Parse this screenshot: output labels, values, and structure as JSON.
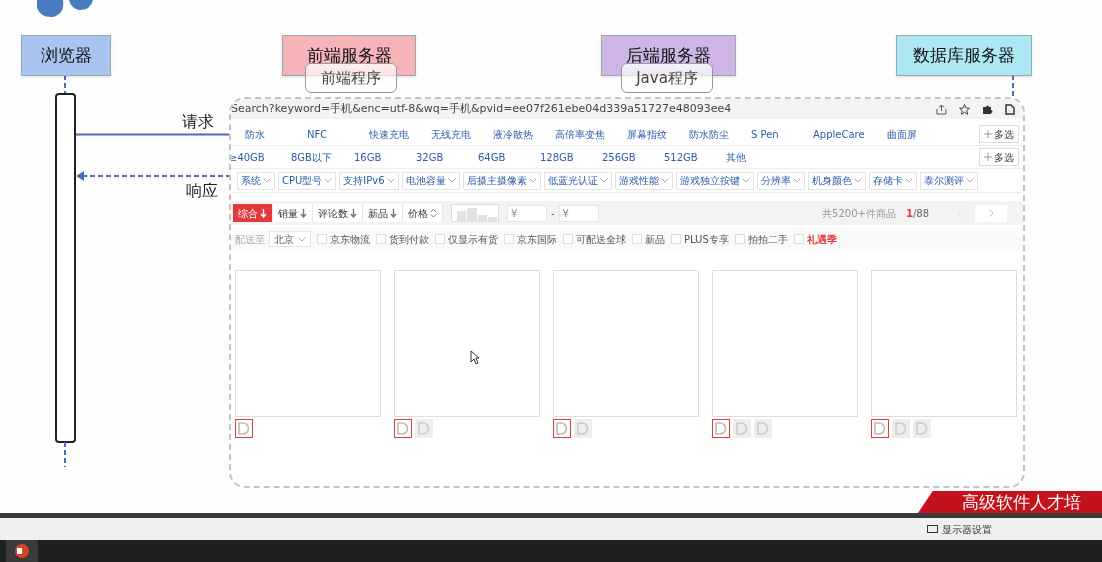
{
  "lifelines": [
    {
      "title": "浏览器",
      "color": "#a9c4f0"
    },
    {
      "title": "前端服务器",
      "color": "#f6b3b8",
      "program": "前端程序"
    },
    {
      "title": "后端服务器",
      "color": "#cdb6e6",
      "program": "Java程序"
    },
    {
      "title": "数据库服务器",
      "color": "#aee8f4"
    }
  ],
  "messages": [
    {
      "label": "请求",
      "kind": "request"
    },
    {
      "label": "响应",
      "kind": "response"
    }
  ],
  "browser_capture": {
    "url": "Search?keyword=手机&enc=utf-8&wq=手机&pvid=ee07f261ebe04d339a51727e48093ee4",
    "filter_rows": [
      {
        "items": [
          "防水",
          "NFC",
          "快速充电",
          "无线充电",
          "液冷散热",
          "高倍率变焦",
          "屏幕指纹",
          "防水防尘",
          "S Pen",
          "AppleCare",
          "曲面屏"
        ],
        "more": "多选"
      },
      {
        "items": [
          "≥40GB",
          "8GB以下",
          "16GB",
          "32GB",
          "64GB",
          "128GB",
          "256GB",
          "512GB",
          "其他"
        ],
        "more": "多选"
      }
    ],
    "dropdowns": [
      "系统",
      "CPU型号",
      "支持IPv6",
      "电池容量",
      "后摄主摄像素",
      "低蓝光认证",
      "游戏性能",
      "游戏独立按键",
      "分辨率",
      "机身颜色",
      "存储卡",
      "泰尔测评"
    ],
    "sort_tabs": [
      {
        "label": "综合",
        "kind": "down",
        "selected": true
      },
      {
        "label": "销量",
        "kind": "down",
        "selected": false
      },
      {
        "label": "评论数",
        "kind": "down",
        "selected": false
      },
      {
        "label": "新品",
        "kind": "down",
        "selected": false
      },
      {
        "label": "价格",
        "kind": "updown",
        "selected": false
      }
    ],
    "price_from": "¥",
    "price_separator": "-",
    "price_to": "¥",
    "total": "共5200+件商品",
    "page_current": "1",
    "page_total": "/88",
    "delivery_label": "配送至",
    "delivery_city": "北京",
    "options": [
      {
        "label": "京东物流",
        "checked": false,
        "kind": "plain"
      },
      {
        "label": "货到付款",
        "checked": false,
        "kind": "plain"
      },
      {
        "label": "仅显示有货",
        "checked": false,
        "kind": "plain"
      },
      {
        "label": "京东国际",
        "checked": false,
        "kind": "plain"
      },
      {
        "label": "可配送全球",
        "checked": false,
        "kind": "plain"
      },
      {
        "label": "新品",
        "checked": false,
        "kind": "plain"
      },
      {
        "label": "PLUS专享",
        "checked": false,
        "kind": "plain"
      },
      {
        "label": "拍拍二手",
        "checked": false,
        "kind": "plain"
      },
      {
        "label": "礼遇季",
        "checked": false,
        "kind": "promo"
      }
    ],
    "products": [
      {
        "tags": [
          {
            "kind": "outlined"
          }
        ]
      },
      {
        "tags": [
          {
            "kind": "outlined"
          },
          {
            "kind": "plain"
          }
        ]
      },
      {
        "tags": [
          {
            "kind": "outlined"
          },
          {
            "kind": "plain"
          }
        ]
      },
      {
        "tags": [
          {
            "kind": "outlined"
          },
          {
            "kind": "plain"
          },
          {
            "kind": "plain"
          }
        ]
      },
      {
        "tags": [
          {
            "kind": "outlined"
          },
          {
            "kind": "plain"
          },
          {
            "kind": "plain"
          }
        ]
      }
    ]
  },
  "banner": "高级软件人才培",
  "status_bar": {
    "text": "显示器设置"
  }
}
